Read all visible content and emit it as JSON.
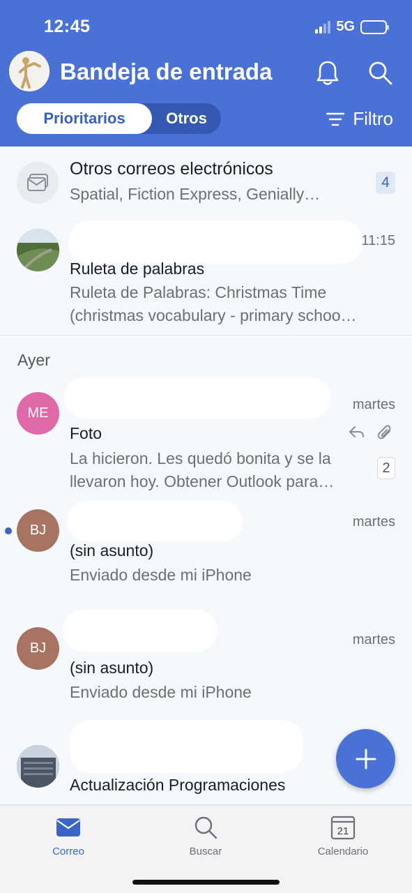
{
  "status_bar": {
    "time": "12:45",
    "network": "5G"
  },
  "header": {
    "title": "Bandeja de entrada",
    "segment_active": "Prioritarios",
    "segment_other": "Otros",
    "filter_label": "Filtro"
  },
  "other_mail": {
    "title": "Otros correos electrónicos",
    "senders": "Spatial, Fiction Express, Genially…",
    "count": "4"
  },
  "messages": [
    {
      "time": "11:15",
      "subject": "Ruleta de palabras",
      "preview": "Ruleta de Palabras: Christmas Time (christmas vocabulary - primary schoo…"
    },
    {
      "initials": "ME",
      "time": "martes",
      "subject": "Foto",
      "preview": "La hicieron. Les quedó bonita y se la llevaron hoy. Obtener Outlook para…",
      "thread_count": "2",
      "avatar_color": "#e06aa8"
    },
    {
      "initials": "BJ",
      "time": "martes",
      "subject": "(sin asunto)",
      "preview": "Enviado desde mi iPhone",
      "avatar_color": "#a87462"
    },
    {
      "initials": "BJ",
      "time": "martes",
      "subject": "(sin asunto)",
      "preview": "Enviado desde mi iPhone",
      "avatar_color": "#a87462"
    },
    {
      "subject": "Actualización Programaciones"
    }
  ],
  "section_yesterday": "Ayer",
  "tabs": {
    "mail": "Correo",
    "search": "Buscar",
    "calendar": "Calendario",
    "calendar_day": "21"
  },
  "colors": {
    "brand": "#4a72d6",
    "accent": "#3a64c8"
  },
  "icons": {
    "bell": "bell-icon",
    "search": "search-icon",
    "filter": "filter-icon",
    "compose": "plus-icon",
    "reply": "reply-icon",
    "attachment": "paperclip-icon"
  }
}
